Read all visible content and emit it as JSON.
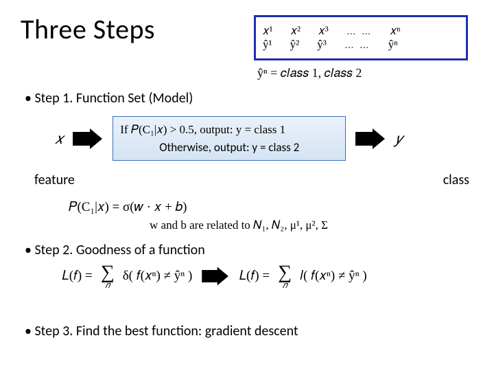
{
  "title": "Three Steps",
  "topbox": {
    "r1c1": "𝑥¹",
    "r1c2": "𝑥²",
    "r1c3": "𝑥³",
    "ellipsis": "… …",
    "r1cn": "𝑥ⁿ",
    "r2c1": "ŷ¹",
    "r2c2": "ŷ²",
    "r2c3": "ŷ³",
    "r2cn": "ŷⁿ"
  },
  "yhat_class": "ŷⁿ = 𝑐𝑙𝑎𝑠𝑠 1, 𝑐𝑙𝑎𝑠𝑠 2",
  "step1": {
    "heading": "Step 1. Function Set (Model)",
    "x": "𝑥",
    "rule_line1": "If 𝑃(C₁|𝑥) > 0.5, output: y = class 1",
    "rule_line2": "Otherwise, output: y = class 2",
    "y": "𝑦",
    "feature_label": "feature",
    "class_label": "class",
    "sigma_eq": "𝑃(C₁|𝑥) = σ(𝑤 · 𝑥 + 𝑏)",
    "relates": "w and b are related to 𝑁₁, 𝑁₂, μ¹, μ², Σ"
  },
  "step2": {
    "heading": "Step 2. Goodness of a function",
    "loss_left_pre": "𝐿(𝑓) = ",
    "loss_left_term": " δ( 𝑓(𝑥ⁿ) ≠ ŷⁿ )",
    "loss_right_pre": "𝐿(𝑓) = ",
    "loss_right_term": " 𝑙( 𝑓(𝑥ⁿ) ≠ ŷⁿ )",
    "sum_symbol": "∑",
    "sum_index": "𝑛"
  },
  "step3": {
    "heading": "Step 3. Find the best function: gradient descent"
  },
  "chart_data": {
    "type": "table",
    "description": "Training data notation: inputs x^1..x^n with corresponding labels ŷ^1..ŷ^n",
    "columns": [
      "x¹",
      "x²",
      "x³",
      "…",
      "xⁿ"
    ],
    "rows": [
      [
        "ŷ¹",
        "ŷ²",
        "ŷ³",
        "…",
        "ŷⁿ"
      ]
    ]
  }
}
